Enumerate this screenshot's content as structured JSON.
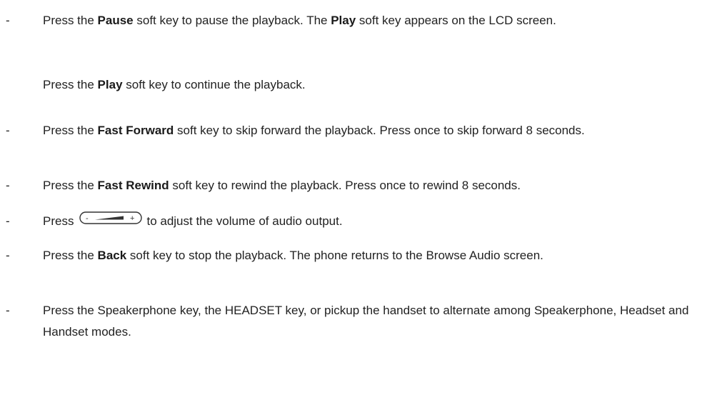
{
  "bullet": "-",
  "items": [
    {
      "pre": "Press the ",
      "bold": "Pause",
      "mid": " soft key to pause the playback. The ",
      "bold2": "Play",
      "post": " soft key appears on the LCD screen."
    },
    {
      "pre": "Press the ",
      "bold": "Play",
      "post": " soft key to continue the playback."
    },
    {
      "pre": "Press the ",
      "bold": "Fast Forward",
      "post": " soft key to skip forward the playback. Press once to skip forward 8 seconds."
    },
    {
      "pre": "Press the ",
      "bold": "Fast Rewind",
      "post": " soft key to rewind the playback. Press once to rewind 8 seconds."
    },
    {
      "pre": "Press",
      "icon": "volume-key-icon",
      "post": "to adjust the volume of audio output."
    },
    {
      "pre": "Press the ",
      "bold": "Back",
      "post": " soft key to stop the playback. The phone returns to the Browse Audio screen."
    },
    {
      "text": "Press the Speakerphone key, the HEADSET key, or pickup the handset to alternate among Speakerphone, Headset and Handset modes."
    }
  ],
  "volume_key": {
    "minus": "-",
    "plus": "+"
  }
}
